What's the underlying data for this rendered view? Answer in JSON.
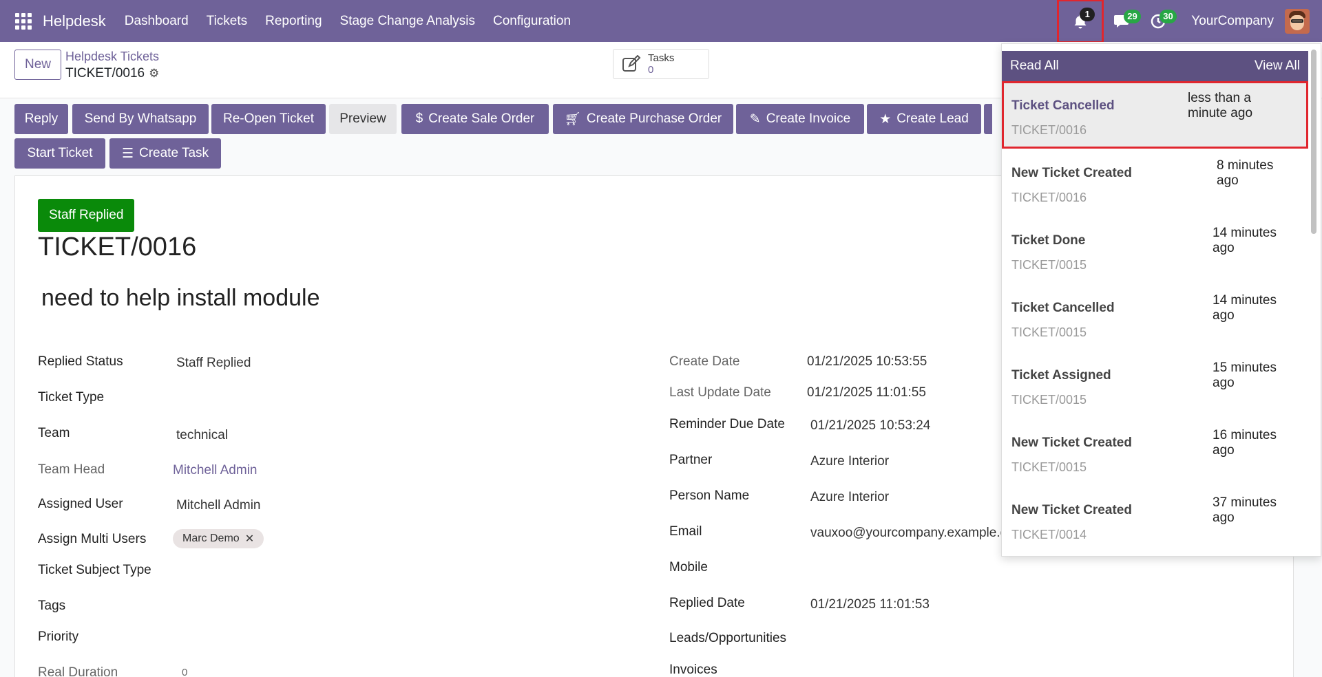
{
  "navbar": {
    "brand": "Helpdesk",
    "menu": [
      "Dashboard",
      "Tickets",
      "Reporting",
      "Stage Change Analysis",
      "Configuration"
    ],
    "notification_count": "1",
    "messages_count": "29",
    "activities_count": "30",
    "company": "YourCompany"
  },
  "control": {
    "new_label": "New",
    "breadcrumb_parent": "Helpdesk Tickets",
    "breadcrumb_current": "TICKET/0016",
    "tasks_label": "Tasks",
    "tasks_count": "0"
  },
  "actions": {
    "reply": "Reply",
    "whatsapp": "Send By Whatsapp",
    "reopen": "Re-Open Ticket",
    "preview": "Preview",
    "sale_order": "Create Sale Order",
    "purchase_order": "Create Purchase Order",
    "invoice": "Create Invoice",
    "lead": "Create Lead",
    "start_ticket": "Start Ticket",
    "create_task": "Create Task"
  },
  "form": {
    "status_badge": "Staff Replied",
    "title": "TICKET/0016",
    "subject": "need to help install module",
    "left": {
      "replied_status_label": "Replied Status",
      "replied_status_value": "Staff Replied",
      "ticket_type_label": "Ticket Type",
      "team_label": "Team",
      "team_value": "technical",
      "team_head_label": "Team Head",
      "team_head_value": "Mitchell Admin",
      "assigned_user_label": "Assigned User",
      "assigned_user_value": "Mitchell Admin",
      "assign_multi_label": "Assign Multi Users",
      "assign_multi_tag": "Marc Demo",
      "subject_type_label": "Ticket Subject Type",
      "tags_label": "Tags",
      "priority_label": "Priority",
      "real_duration_label": "Real Duration",
      "real_duration_value": "0"
    },
    "right": {
      "create_date_label": "Create Date",
      "create_date_value": "01/21/2025 10:53:55",
      "last_update_label": "Last Update Date",
      "last_update_value": "01/21/2025 11:01:55",
      "reminder_label": "Reminder Due Date",
      "reminder_value": "01/21/2025 10:53:24",
      "partner_label": "Partner",
      "partner_value": "Azure Interior",
      "person_label": "Person Name",
      "person_value": "Azure Interior",
      "email_label": "Email",
      "email_value": "vauxoo@yourcompany.example.c",
      "mobile_label": "Mobile",
      "replied_date_label": "Replied Date",
      "replied_date_value": "01/21/2025 11:01:53",
      "leads_label": "Leads/Opportunities",
      "invoices_label": "Invoices"
    }
  },
  "notifications": {
    "read_all": "Read All",
    "view_all": "View All",
    "items": [
      {
        "title": "Ticket Cancelled",
        "ticket": "TICKET/0016",
        "time": "less than a minute ago"
      },
      {
        "title": "New Ticket Created",
        "ticket": "TICKET/0016",
        "time": "8 minutes ago"
      },
      {
        "title": "Ticket Done",
        "ticket": "TICKET/0015",
        "time": "14 minutes ago"
      },
      {
        "title": "Ticket Cancelled",
        "ticket": "TICKET/0015",
        "time": "14 minutes ago"
      },
      {
        "title": "Ticket Assigned",
        "ticket": "TICKET/0015",
        "time": "15 minutes ago"
      },
      {
        "title": "New Ticket Created",
        "ticket": "TICKET/0015",
        "time": "16 minutes ago"
      },
      {
        "title": "New Ticket Created",
        "ticket": "TICKET/0014",
        "time": "37 minutes ago"
      }
    ]
  },
  "colors": {
    "brand": "#6f6299",
    "notif_header": "#5d5181",
    "status_green": "#0a8a0a",
    "highlight_red": "#e0262e"
  }
}
